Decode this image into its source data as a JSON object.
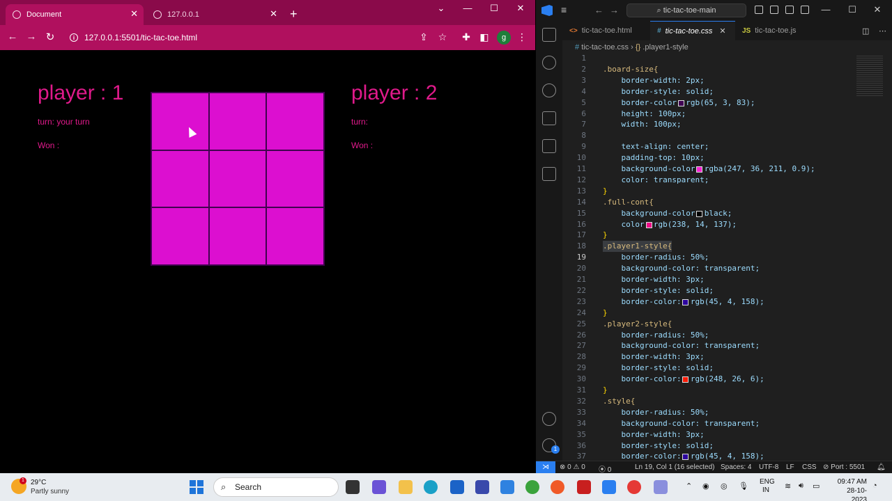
{
  "browser": {
    "tabs": [
      {
        "title": "Document",
        "active": true
      },
      {
        "title": "127.0.0.1",
        "active": false
      }
    ],
    "url": "127.0.0.1:5501/tic-tac-toe.html",
    "profile_initial": "g",
    "theme_color": "#b0105e"
  },
  "game": {
    "player1": {
      "name": "player : 1",
      "turn_label": "turn: your turn",
      "won_label": "Won :"
    },
    "player2": {
      "name": "player : 2",
      "turn_label": "turn:",
      "won_label": "Won :"
    },
    "cell_color": "#dc0fd0",
    "text_color": "#e01a8b",
    "cells": [
      "",
      "",
      "",
      "",
      "",
      "",
      "",
      "",
      ""
    ]
  },
  "vscode": {
    "search": "tic-tac-toe-main",
    "tabs": [
      {
        "icon": "<>",
        "label": "tic-tac-toe.html",
        "active": false
      },
      {
        "icon": "#",
        "label": "tic-tac-toe.css",
        "active": true
      },
      {
        "icon": "JS",
        "label": "tic-tac-toe.js",
        "active": false
      }
    ],
    "breadcrumb_file": "tic-tac-toe.css",
    "breadcrumb_symbol": ".player1-style",
    "status": {
      "errors": "0",
      "warnings": "0",
      "ports": "0",
      "cursor": "Ln 19, Col 1 (16 selected)",
      "spaces": "Spaces: 4",
      "encoding": "UTF-8",
      "eol": "LF",
      "language": "CSS",
      "port": "Port : 5501"
    }
  },
  "code_lines": [
    {
      "n": "1",
      "t": ""
    },
    {
      "n": "2",
      "t": ".board-size{"
    },
    {
      "n": "3",
      "t": "    border-width: 2px;"
    },
    {
      "n": "4",
      "t": "    border-style: solid;"
    },
    {
      "n": "5",
      "t": "    border-color: rgb(65, 3, 83);",
      "swatch": "#410353"
    },
    {
      "n": "6",
      "t": "    height: 100px;"
    },
    {
      "n": "7",
      "t": "    width: 100px;"
    },
    {
      "n": "8",
      "t": ""
    },
    {
      "n": "9",
      "t": "    text-align: center;"
    },
    {
      "n": "10",
      "t": "    padding-top: 10px;"
    },
    {
      "n": "11",
      "t": "    background-color: rgba(247, 36, 211, 0.9);",
      "swatch": "#f724d3"
    },
    {
      "n": "12",
      "t": "    color: transparent;"
    },
    {
      "n": "13",
      "t": "}"
    },
    {
      "n": "14",
      "t": ".full-cont{"
    },
    {
      "n": "15",
      "t": "    background-color: black;",
      "swatch": "#000000"
    },
    {
      "n": "16",
      "t": "    color: rgb(238, 14, 137);",
      "swatch": "#ee0e89"
    },
    {
      "n": "17",
      "t": "}"
    },
    {
      "n": "18",
      "t": ".player1-style{",
      "highlight": true
    },
    {
      "n": "19",
      "t": "    border-radius: 50%;",
      "current": true
    },
    {
      "n": "20",
      "t": "    background-color: transparent;"
    },
    {
      "n": "21",
      "t": "    border-width: 3px;"
    },
    {
      "n": "22",
      "t": "    border-style: solid;"
    },
    {
      "n": "23",
      "t": "    border-color:  rgb(45, 4, 158);",
      "swatch": "#2d049e"
    },
    {
      "n": "24",
      "t": "}"
    },
    {
      "n": "25",
      "t": ".player2-style{"
    },
    {
      "n": "26",
      "t": "    border-radius: 50%;"
    },
    {
      "n": "27",
      "t": "    background-color: transparent;"
    },
    {
      "n": "28",
      "t": "    border-width: 3px;"
    },
    {
      "n": "29",
      "t": "    border-style: solid;"
    },
    {
      "n": "30",
      "t": "    border-color:  rgb(248, 26, 6);",
      "swatch": "#f81a06"
    },
    {
      "n": "31",
      "t": "}"
    },
    {
      "n": "32",
      "t": ".style{"
    },
    {
      "n": "33",
      "t": "    border-radius: 50%;"
    },
    {
      "n": "34",
      "t": "    background-color: transparent;"
    },
    {
      "n": "35",
      "t": "    border-width: 3px;"
    },
    {
      "n": "36",
      "t": "    border-style: solid;"
    },
    {
      "n": "37",
      "t": "    border-color:  rgb(45, 4, 158);",
      "swatch": "#2d049e"
    }
  ],
  "taskbar": {
    "weather_temp": "29°C",
    "weather_desc": "Partly sunny",
    "weather_badge": "1",
    "search_label": "Search",
    "lang_1": "ENG",
    "lang_2": "IN",
    "time": "09:47 AM",
    "date": "28-10-2023"
  }
}
